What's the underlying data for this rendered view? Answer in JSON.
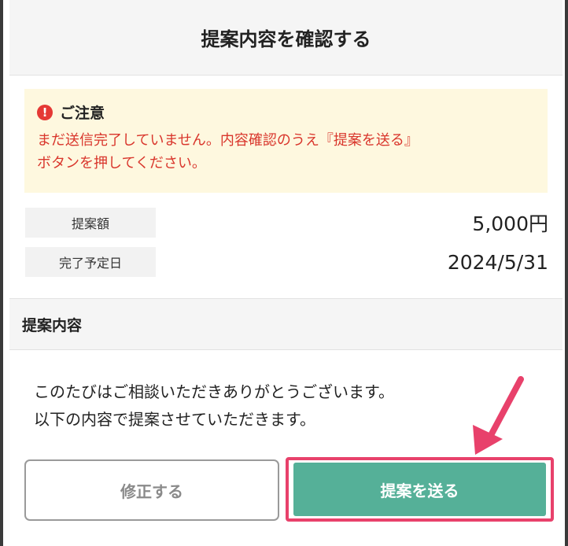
{
  "dialog": {
    "title": "提案内容を確認する"
  },
  "notice": {
    "icon": "exclamation-circle-icon",
    "icon_glyph": "!",
    "heading": "ご注意",
    "line1": "まだ送信完了していません。内容確認のうえ『提案を送る』",
    "line2": "ボタンを押してください。"
  },
  "details": [
    {
      "label": "提案額",
      "value": "5,000円"
    },
    {
      "label": "完了予定日",
      "value": "2024/5/31"
    }
  ],
  "proposal_section": {
    "heading": "提案内容",
    "message_line1": "このたびはご相談いただきありがとうございます。",
    "message_line2": "以下の内容で提案させていただきます。"
  },
  "actions": {
    "edit_label": "修正する",
    "send_label": "提案を送る"
  },
  "colors": {
    "send_button": "#55b098",
    "highlight": "#e8416b",
    "notice_bg": "#fef8df",
    "notice_text": "#d9362c",
    "alert_icon": "#e53935"
  }
}
